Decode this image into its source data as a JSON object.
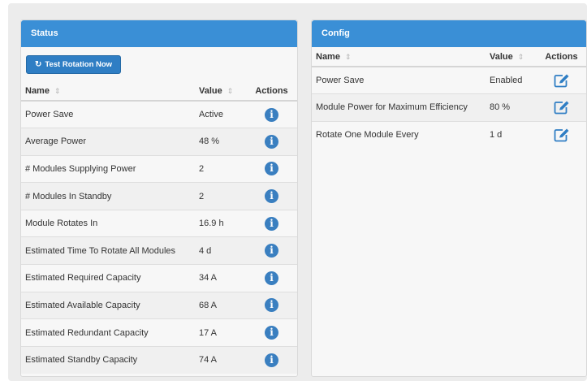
{
  "status": {
    "title": "Status",
    "test_button_icon": "refresh-icon",
    "test_button_label": "Test Rotation Now",
    "columns": {
      "name": "Name",
      "value": "Value",
      "actions": "Actions"
    },
    "sort_glyph": "⇕",
    "rows": [
      {
        "name": "Power Save",
        "value": "Active"
      },
      {
        "name": "Average Power",
        "value": "48 %"
      },
      {
        "name": "# Modules Supplying Power",
        "value": "2"
      },
      {
        "name": "# Modules In Standby",
        "value": "2"
      },
      {
        "name": "Module Rotates In",
        "value": "16.9 h"
      },
      {
        "name": "Estimated Time To Rotate All Modules",
        "value": "4 d"
      },
      {
        "name": "Estimated Required Capacity",
        "value": "34 A"
      },
      {
        "name": "Estimated Available Capacity",
        "value": "68 A"
      },
      {
        "name": "Estimated Redundant Capacity",
        "value": "17 A"
      },
      {
        "name": "Estimated Standby Capacity",
        "value": "74 A"
      }
    ],
    "action_icon": "info-icon",
    "info_glyph": "i"
  },
  "config": {
    "title": "Config",
    "columns": {
      "name": "Name",
      "value": "Value",
      "actions": "Actions"
    },
    "sort_glyph": "⇕",
    "rows": [
      {
        "name": "Power Save",
        "value": "Enabled"
      },
      {
        "name": "Module Power for Maximum Efficiency",
        "value": "80 %"
      },
      {
        "name": "Rotate One Module Every",
        "value": "1 d"
      }
    ],
    "action_icon": "edit-icon"
  },
  "colors": {
    "heading": "#3a8fd6",
    "button": "#2f7ec4",
    "info": "#3a7fc0"
  }
}
